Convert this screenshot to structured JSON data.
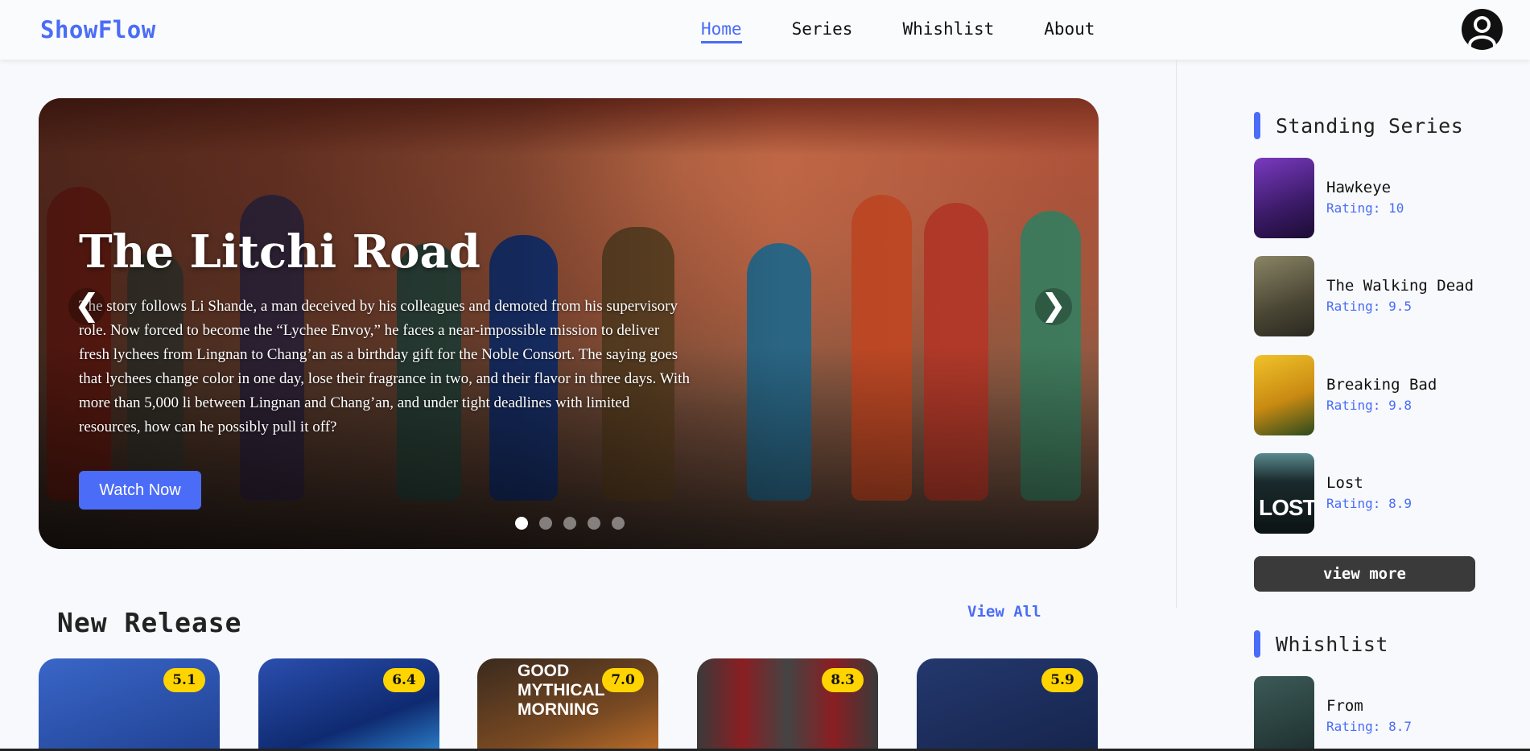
{
  "header": {
    "logo": "ShowFlow",
    "nav": [
      {
        "label": "Home",
        "active": true
      },
      {
        "label": "Series"
      },
      {
        "label": "Whishlist"
      },
      {
        "label": "About"
      }
    ]
  },
  "hero": {
    "title": "The Litchi Road",
    "description": "The story follows Li Shande, a man deceived by his colleagues and demoted from his supervisory role. Now forced to become the “Lychee Envoy,” he faces a near-impossible mission to deliver fresh lychees from Lingnan to Chang’an as a birthday gift for the Noble Consort. The saying goes that lychees change color in one day, lose their fragrance in two, and their flavor in three days. With more than 5,000 li between Lingnan and Chang’an, and under tight deadlines with limited resources, how can he possibly pull it off?",
    "button": "Watch Now",
    "prev": "❮",
    "next": "❯",
    "slides": 5,
    "active_slide": 1
  },
  "new_release": {
    "title": "New Release",
    "view_all": "View All",
    "items": [
      {
        "rating": "5.1",
        "color": "#2a4fa8"
      },
      {
        "rating": "6.4",
        "color": "#1d3f9a"
      },
      {
        "rating": "7.0",
        "color": "#b8661c",
        "text": "GOOD MYTHICAL MORNING"
      },
      {
        "rating": "8.3",
        "color": "#7d1f22"
      },
      {
        "rating": "5.9",
        "color": "#1c2f66"
      }
    ]
  },
  "sidebar": {
    "standing": {
      "title": "Standing Series",
      "items": [
        {
          "name": "Hawkeye",
          "rating": "Rating: 10",
          "color": "#5b2a8c"
        },
        {
          "name": "The Walking Dead",
          "rating": "Rating: 9.5",
          "color": "#5e5a43"
        },
        {
          "name": "Breaking Bad",
          "rating": "Rating: 9.8",
          "color": "#d8a51f"
        },
        {
          "name": "Lost",
          "rating": "Rating: 8.9",
          "color": "#1b2b2c",
          "text": "LOST"
        }
      ],
      "view_more": "view more"
    },
    "whishlist": {
      "title": "Whishlist",
      "items": [
        {
          "name": "From",
          "rating": "Rating: 8.7",
          "color": "#243b3a"
        }
      ]
    }
  }
}
